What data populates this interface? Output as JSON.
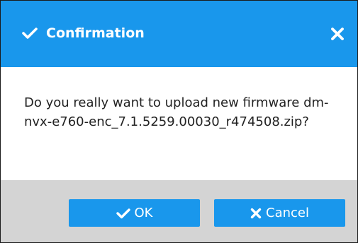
{
  "dialog": {
    "title": "Confirmation",
    "title_icon": "check-icon",
    "close_icon": "close-icon",
    "message": "Do you really want to upload new firmware dm-nvx-e760-enc_7.1.5259.00030_r474508.zip?",
    "buttons": {
      "ok": {
        "label": "OK",
        "icon": "check-icon"
      },
      "cancel": {
        "label": "Cancel",
        "icon": "close-icon"
      }
    }
  },
  "colors": {
    "accent": "#1997ec",
    "footer_bg": "#d4d4d4",
    "text": "#222222"
  }
}
